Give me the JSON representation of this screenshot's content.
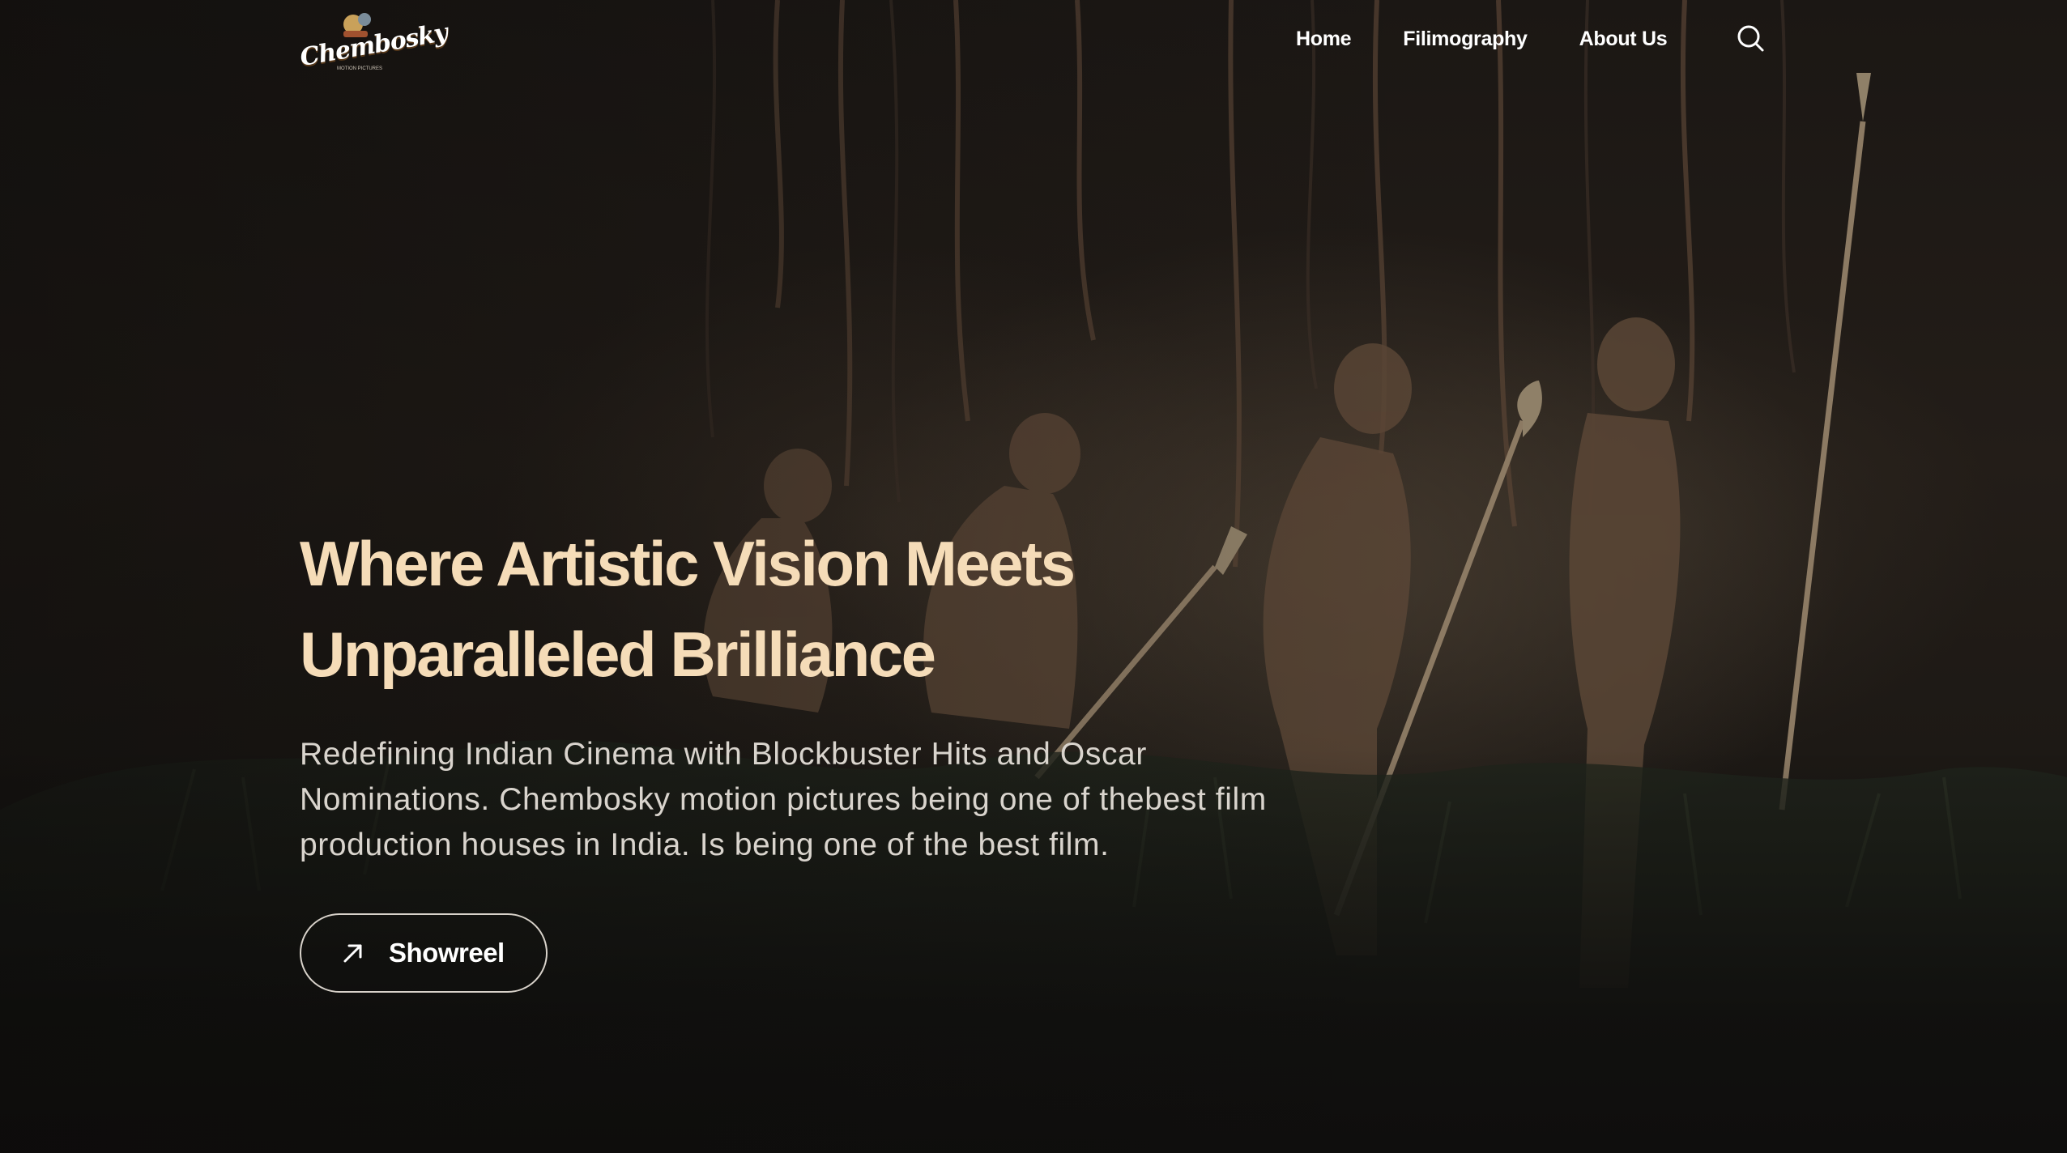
{
  "brand": {
    "logo_text": "Chembosky",
    "logo_subtext": "MOTION PICTURES"
  },
  "nav": {
    "items": [
      {
        "label": "Home"
      },
      {
        "label": "Filimography"
      },
      {
        "label": "About Us"
      }
    ],
    "search_icon": "search-icon"
  },
  "hero": {
    "headline_line1": "Where Artistic Vision Meets",
    "headline_line2": "Unparalleled Brilliance",
    "subtitle_line1": "Redefining Indian Cinema with Blockbuster Hits and Oscar",
    "subtitle_line2": "Nominations. Chembosky motion pictures being one of thebest film",
    "subtitle_line3": "production houses in India. Is being one of the best film.",
    "cta_label": "Showreel",
    "cta_icon": "arrow-up-right-icon"
  },
  "colors": {
    "headline": "#f5dcb8",
    "text": "#d9d4cd",
    "background": "#0f0e0d"
  }
}
